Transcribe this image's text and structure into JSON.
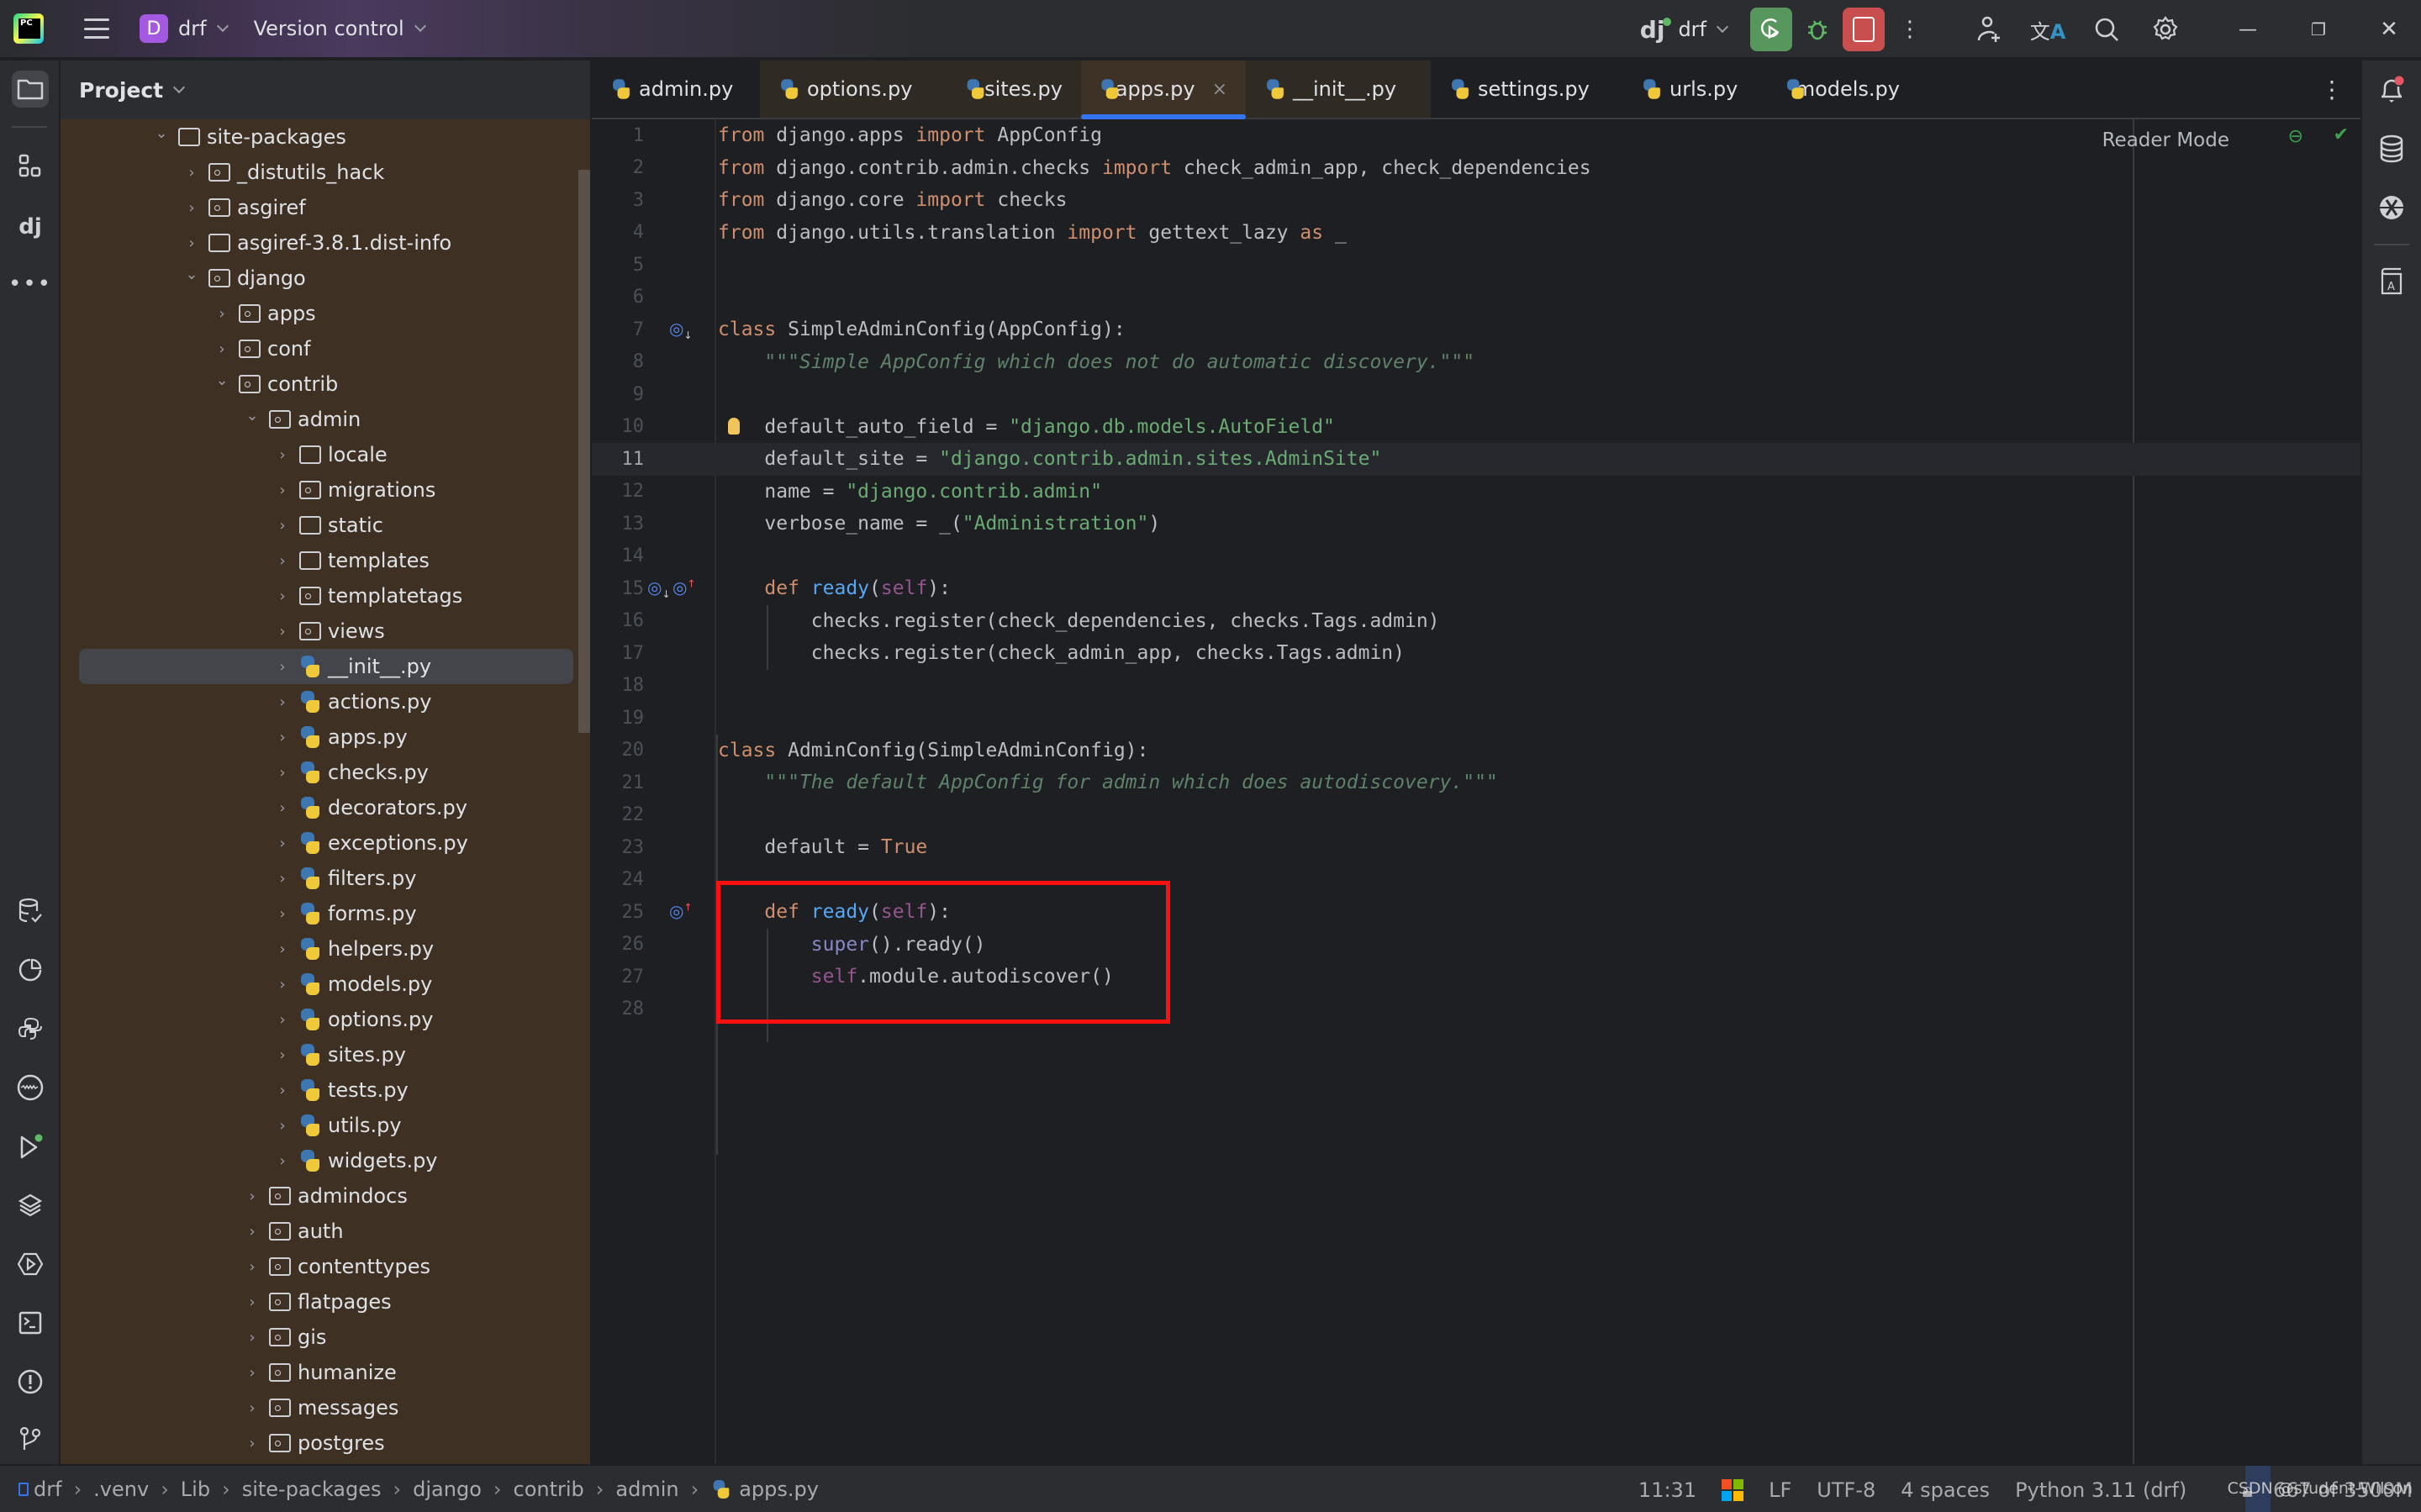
{
  "titlebar": {
    "project_badge": "D",
    "project_name": "drf",
    "vcs_label": "Version control",
    "run_config": "drf",
    "icons": [
      "hamburger-menu-icon",
      "django-icon",
      "rerun-icon",
      "debug-icon",
      "stop-icon",
      "more-icon",
      "add-user-icon",
      "translate-icon",
      "search-icon",
      "gear-icon",
      "minimize-icon",
      "restore-icon",
      "close-icon"
    ]
  },
  "left_toolbar": {
    "icons": [
      "project-folder-icon",
      "structure-icon",
      "django-structure-icon",
      "more-tools-icon",
      "database-check-icon",
      "coverage-icon",
      "python-console-icon",
      "problems-wave-icon",
      "run-icon",
      "layers-icon",
      "services-icon",
      "terminal-icon",
      "problems-icon",
      "git-icon"
    ]
  },
  "project_panel": {
    "title": "Project",
    "tree": [
      {
        "label": "site-packages",
        "type": "folder",
        "depth": 0,
        "expanded": true
      },
      {
        "label": "_distutils_hack",
        "type": "package",
        "depth": 1,
        "expanded": false
      },
      {
        "label": "asgiref",
        "type": "package",
        "depth": 1,
        "expanded": false
      },
      {
        "label": "asgiref-3.8.1.dist-info",
        "type": "folder",
        "depth": 1,
        "expanded": false
      },
      {
        "label": "django",
        "type": "package",
        "depth": 1,
        "expanded": true
      },
      {
        "label": "apps",
        "type": "package",
        "depth": 2,
        "expanded": false
      },
      {
        "label": "conf",
        "type": "package",
        "depth": 2,
        "expanded": false
      },
      {
        "label": "contrib",
        "type": "package",
        "depth": 2,
        "expanded": true
      },
      {
        "label": "admin",
        "type": "package",
        "depth": 3,
        "expanded": true
      },
      {
        "label": "locale",
        "type": "folder",
        "depth": 4,
        "expanded": false
      },
      {
        "label": "migrations",
        "type": "package",
        "depth": 4,
        "expanded": false
      },
      {
        "label": "static",
        "type": "folder",
        "depth": 4,
        "expanded": false
      },
      {
        "label": "templates",
        "type": "folder",
        "depth": 4,
        "expanded": false
      },
      {
        "label": "templatetags",
        "type": "package",
        "depth": 4,
        "expanded": false
      },
      {
        "label": "views",
        "type": "package",
        "depth": 4,
        "expanded": false
      },
      {
        "label": "__init__.py",
        "type": "python",
        "depth": 4,
        "expanded": false,
        "selected": true
      },
      {
        "label": "actions.py",
        "type": "python",
        "depth": 4,
        "expanded": false
      },
      {
        "label": "apps.py",
        "type": "python",
        "depth": 4,
        "expanded": false
      },
      {
        "label": "checks.py",
        "type": "python",
        "depth": 4,
        "expanded": false
      },
      {
        "label": "decorators.py",
        "type": "python",
        "depth": 4,
        "expanded": false
      },
      {
        "label": "exceptions.py",
        "type": "python",
        "depth": 4,
        "expanded": false
      },
      {
        "label": "filters.py",
        "type": "python",
        "depth": 4,
        "expanded": false
      },
      {
        "label": "forms.py",
        "type": "python",
        "depth": 4,
        "expanded": false
      },
      {
        "label": "helpers.py",
        "type": "python",
        "depth": 4,
        "expanded": false
      },
      {
        "label": "models.py",
        "type": "python",
        "depth": 4,
        "expanded": false
      },
      {
        "label": "options.py",
        "type": "python",
        "depth": 4,
        "expanded": false
      },
      {
        "label": "sites.py",
        "type": "python",
        "depth": 4,
        "expanded": false
      },
      {
        "label": "tests.py",
        "type": "python",
        "depth": 4,
        "expanded": false
      },
      {
        "label": "utils.py",
        "type": "python",
        "depth": 4,
        "expanded": false
      },
      {
        "label": "widgets.py",
        "type": "python",
        "depth": 4,
        "expanded": false
      },
      {
        "label": "admindocs",
        "type": "package",
        "depth": 3,
        "expanded": false
      },
      {
        "label": "auth",
        "type": "package",
        "depth": 3,
        "expanded": false
      },
      {
        "label": "contenttypes",
        "type": "package",
        "depth": 3,
        "expanded": false
      },
      {
        "label": "flatpages",
        "type": "package",
        "depth": 3,
        "expanded": false
      },
      {
        "label": "gis",
        "type": "package",
        "depth": 3,
        "expanded": false
      },
      {
        "label": "humanize",
        "type": "package",
        "depth": 3,
        "expanded": false
      },
      {
        "label": "messages",
        "type": "package",
        "depth": 3,
        "expanded": false
      },
      {
        "label": "postgres",
        "type": "package",
        "depth": 3,
        "expanded": false
      }
    ]
  },
  "tabs": [
    {
      "label": "admin.py",
      "state": "normal"
    },
    {
      "label": "options.py",
      "state": "modified"
    },
    {
      "label": "sites.py",
      "state": "modified"
    },
    {
      "label": "apps.py",
      "state": "active",
      "close": "×"
    },
    {
      "label": "__init__.py",
      "state": "modified"
    },
    {
      "label": "settings.py",
      "state": "normal"
    },
    {
      "label": "urls.py",
      "state": "normal"
    },
    {
      "label": "models.py",
      "state": "normal"
    }
  ],
  "editor": {
    "reader_mode": "Reader Mode",
    "current_line": 11,
    "highlight_box": {
      "from_line": 25,
      "to_line": 27,
      "color": "#ff1010"
    },
    "lines": [
      [
        [
          "kw",
          "from"
        ],
        [
          "plain",
          " django.apps "
        ],
        [
          "kw",
          "import"
        ],
        [
          "plain",
          " AppConfig"
        ]
      ],
      [
        [
          "kw",
          "from"
        ],
        [
          "plain",
          " django.contrib.admin.checks "
        ],
        [
          "kw",
          "import"
        ],
        [
          "plain",
          " check_admin_app, check_dependencies"
        ]
      ],
      [
        [
          "kw",
          "from"
        ],
        [
          "plain",
          " django.core "
        ],
        [
          "kw",
          "import"
        ],
        [
          "plain",
          " checks"
        ]
      ],
      [
        [
          "kw",
          "from"
        ],
        [
          "plain",
          " django.utils.translation "
        ],
        [
          "kw",
          "import"
        ],
        [
          "plain",
          " gettext_lazy "
        ],
        [
          "kw",
          "as"
        ],
        [
          "plain",
          " _"
        ]
      ],
      [],
      [],
      [
        [
          "kw",
          "class"
        ],
        [
          "plain",
          " SimpleAdminConfig(AppConfig):"
        ]
      ],
      [
        [
          "plain",
          "    "
        ],
        [
          "doc",
          "\"\"\"Simple AppConfig which does not do automatic discovery.\"\"\""
        ]
      ],
      [],
      [
        [
          "plain",
          "    default_auto_field = "
        ],
        [
          "str",
          "\"django.db.models.AutoField\""
        ]
      ],
      [
        [
          "plain",
          "    default_site = "
        ],
        [
          "str",
          "\"django.contrib.admin.sites.AdminSite\""
        ]
      ],
      [
        [
          "plain",
          "    name = "
        ],
        [
          "str",
          "\"django.contrib.admin\""
        ]
      ],
      [
        [
          "plain",
          "    verbose_name = _("
        ],
        [
          "str",
          "\"Administration\""
        ],
        [
          "plain",
          ")"
        ]
      ],
      [],
      [
        [
          "plain",
          "    "
        ],
        [
          "kw",
          "def"
        ],
        [
          "plain",
          " "
        ],
        [
          "fn",
          "ready"
        ],
        [
          "plain",
          "("
        ],
        [
          "slf",
          "self"
        ],
        [
          "plain",
          "):"
        ]
      ],
      [
        [
          "plain",
          "        checks.register(check_dependencies, checks.Tags.admin)"
        ]
      ],
      [
        [
          "plain",
          "        checks.register(check_admin_app, checks.Tags.admin)"
        ]
      ],
      [],
      [],
      [
        [
          "kw",
          "class"
        ],
        [
          "plain",
          " AdminConfig(SimpleAdminConfig):"
        ]
      ],
      [
        [
          "plain",
          "    "
        ],
        [
          "doc",
          "\"\"\"The default AppConfig for admin which does autodiscovery.\"\"\""
        ]
      ],
      [],
      [
        [
          "plain",
          "    default = "
        ],
        [
          "kw",
          "True"
        ]
      ],
      [],
      [
        [
          "plain",
          "    "
        ],
        [
          "kw",
          "def"
        ],
        [
          "plain",
          " "
        ],
        [
          "fn",
          "ready"
        ],
        [
          "plain",
          "("
        ],
        [
          "slf",
          "self"
        ],
        [
          "plain",
          "):"
        ]
      ],
      [
        [
          "plain",
          "        "
        ],
        [
          "bi",
          "super"
        ],
        [
          "plain",
          "().ready()"
        ]
      ],
      [
        [
          "plain",
          "        "
        ],
        [
          "slf",
          "self"
        ],
        [
          "plain",
          ".module.autodiscover()"
        ]
      ],
      []
    ],
    "gutter_marks": [
      {
        "line": 7,
        "icons": [
          "implemented-icon"
        ]
      },
      {
        "line": 10,
        "icons": [
          "intention-bulb-icon"
        ]
      },
      {
        "line": 15,
        "icons": [
          "implemented-icon",
          "overrides-icon"
        ]
      },
      {
        "line": 25,
        "icons": [
          "overrides-icon"
        ]
      }
    ]
  },
  "right_toolbar": {
    "icons": [
      "notifications-icon",
      "database-icon",
      "sciview-icon",
      "documentation-icon"
    ]
  },
  "statusbar": {
    "breadcrumb": [
      "drf",
      ".venv",
      "Lib",
      "site-packages",
      "django",
      "contrib",
      "admin",
      "apps.py"
    ],
    "position": "11:31",
    "line_separator": "LF",
    "encoding": "UTF-8",
    "indent": "4 spaces",
    "interpreter": "Python 3.11 (drf)",
    "memory": "667 of 3500M",
    "watermark": "CSDN @student-Wilson"
  },
  "colors": {
    "accent": "#3574f0",
    "run_green": "#57965c",
    "stop_red": "#c94f4f",
    "project_badge": "#a35ae0",
    "annotation_red": "#ff1010"
  }
}
